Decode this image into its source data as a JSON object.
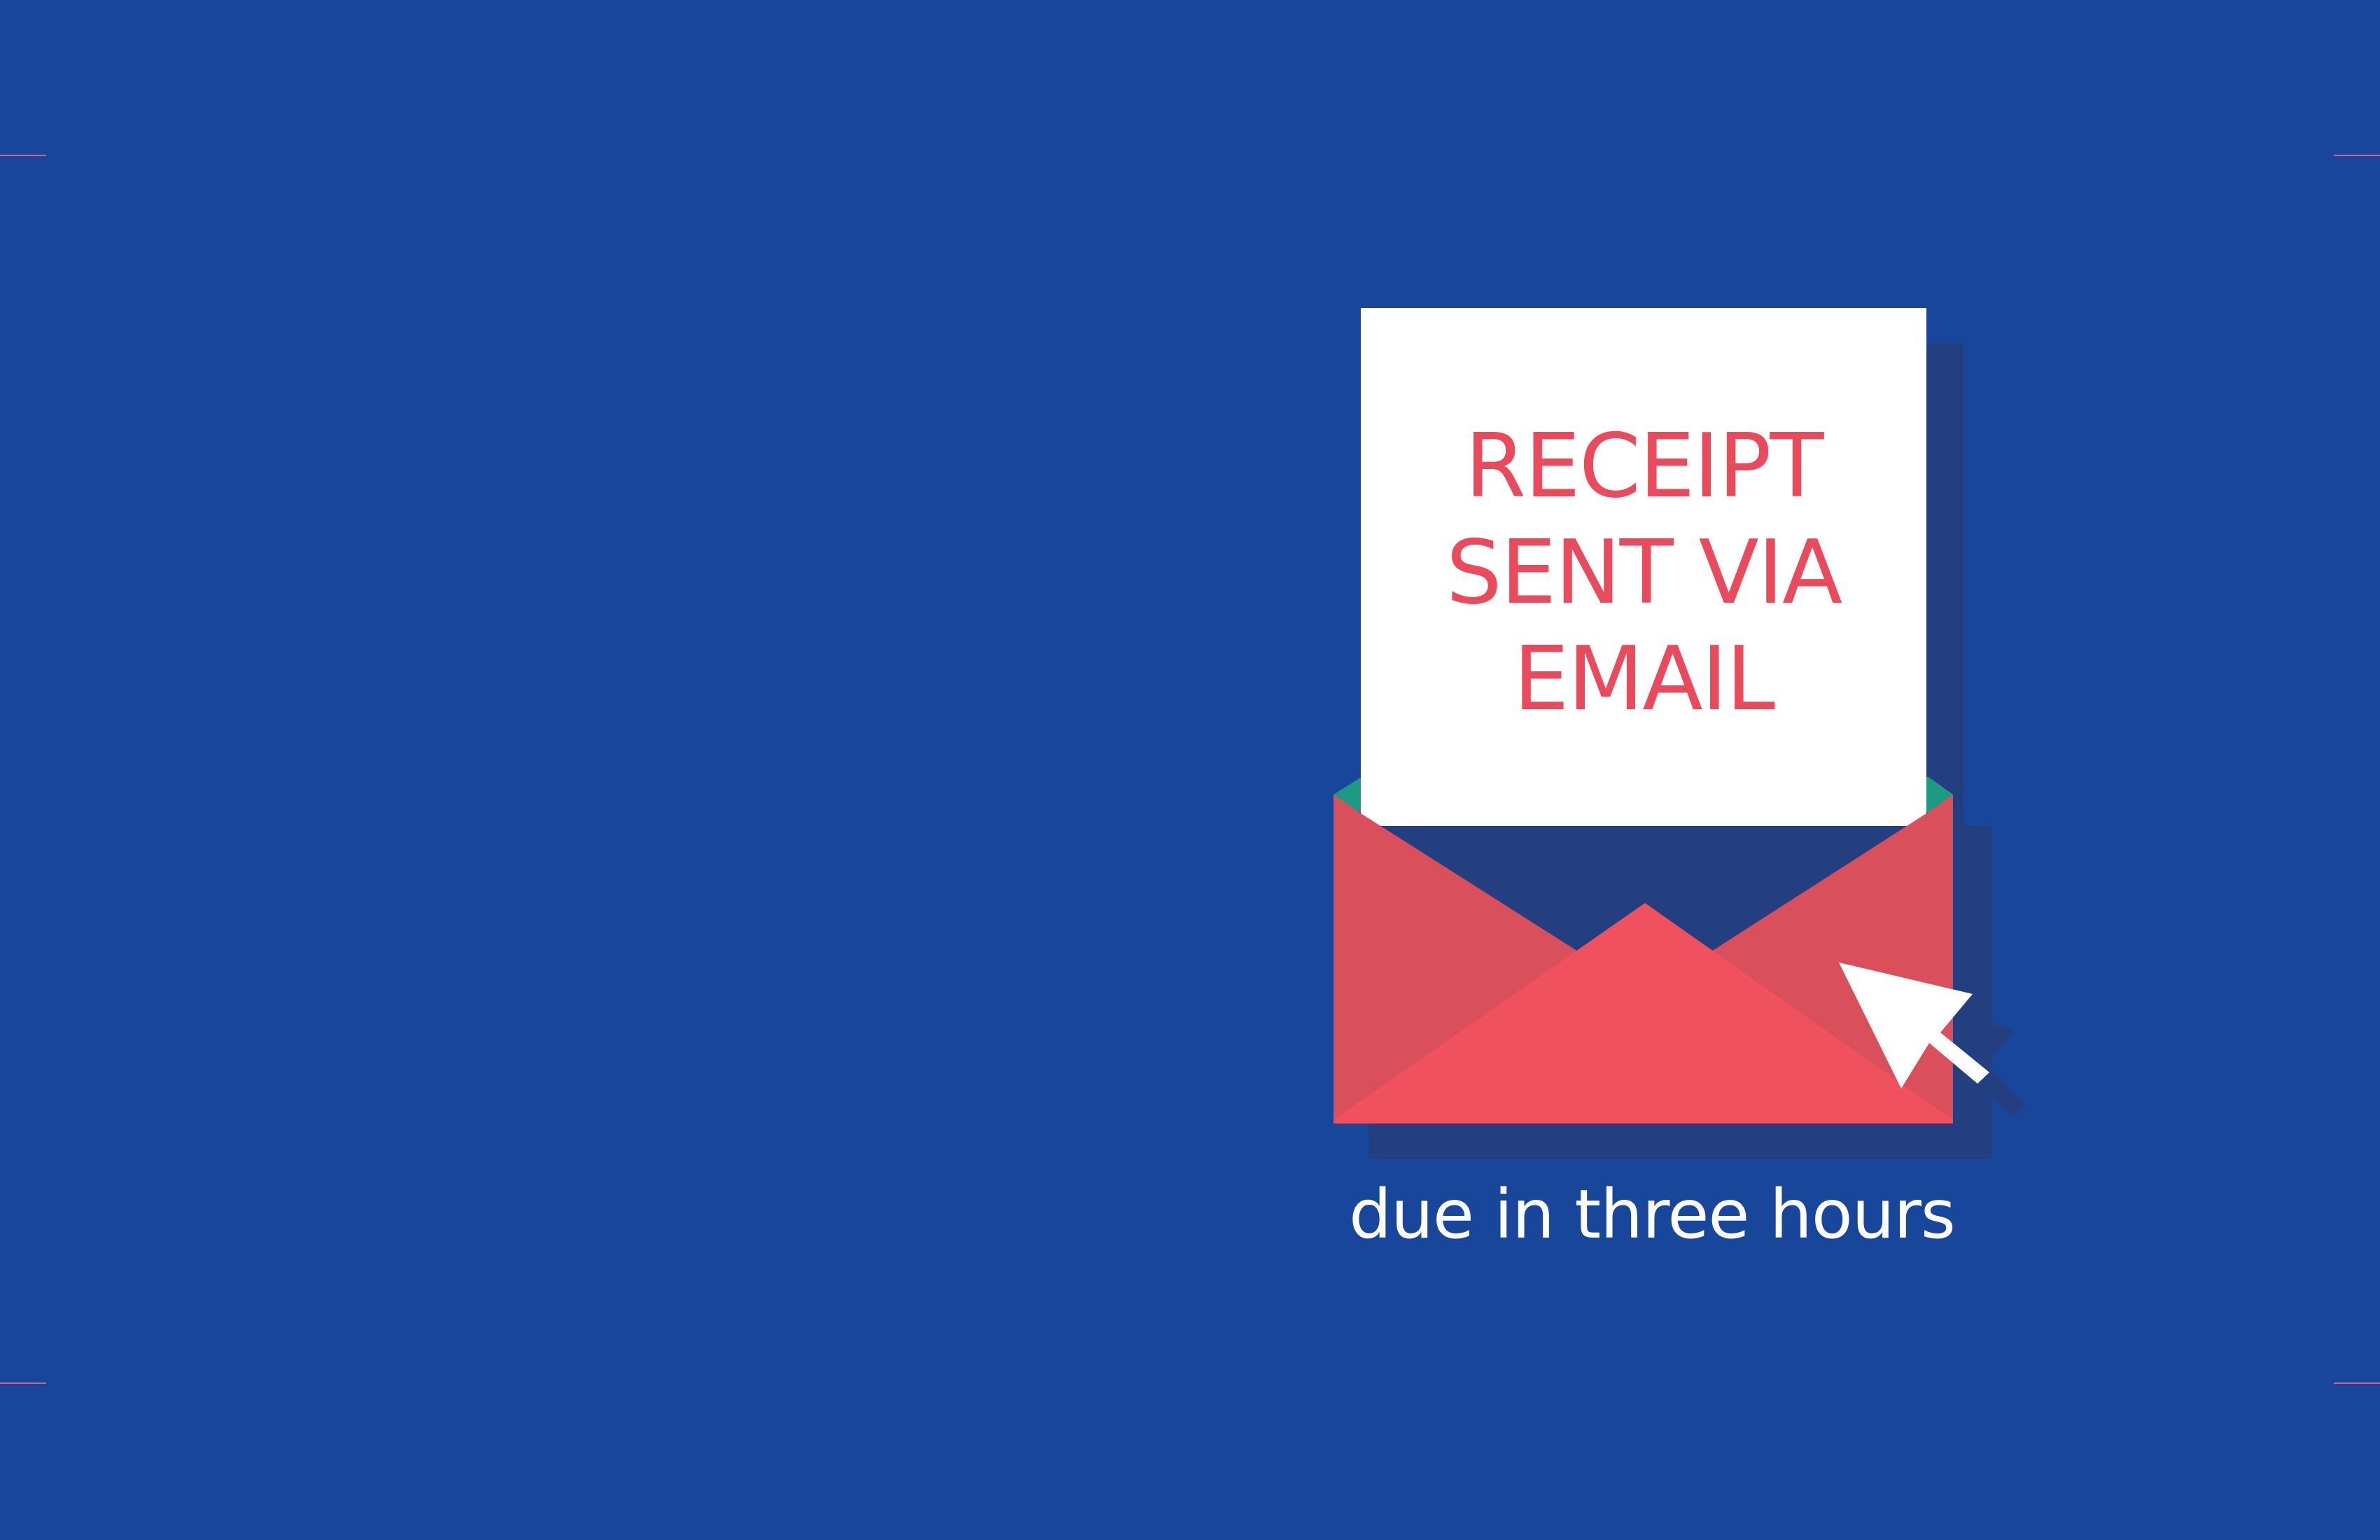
{
  "colors": {
    "background": "#18469b",
    "shadow": "#243f7f",
    "paper": "#ffffff",
    "envelope_back": "#d94f5c",
    "envelope_front": "#ef525e",
    "envelope_lining": "#1d9a82",
    "heading_text": "#ea4b5c",
    "caption_text": "#ffffff",
    "crop_marks": "#d4608a"
  },
  "card": {
    "heading_lines": [
      "RECEIPT",
      "SENT VIA",
      "EMAIL"
    ],
    "caption": "due in three hours"
  },
  "icons": {
    "envelope": "envelope-icon",
    "cursor": "cursor-arrow-icon",
    "paper": "receipt-paper-icon"
  }
}
